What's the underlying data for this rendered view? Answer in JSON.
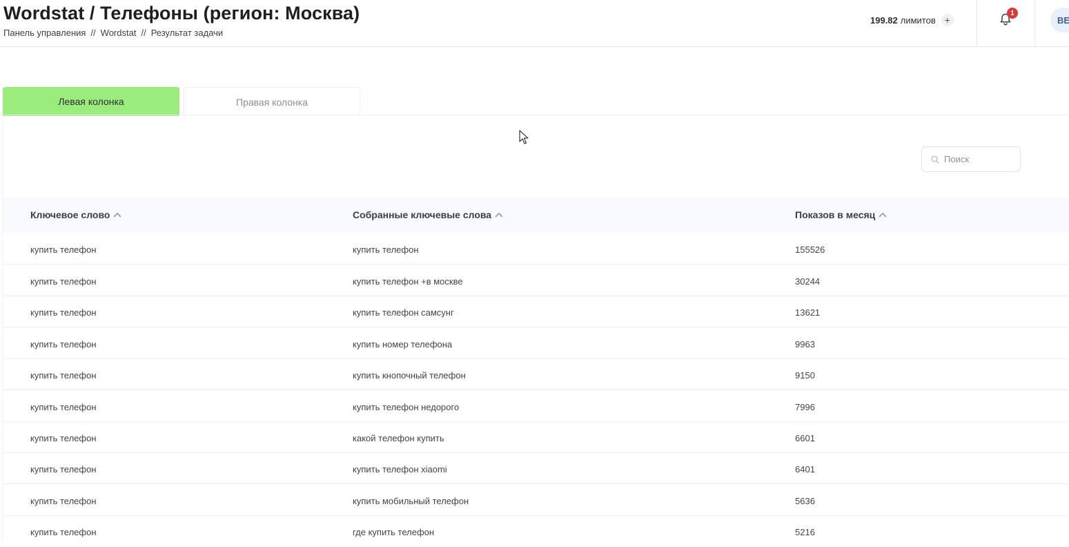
{
  "header": {
    "title": "Wordstat / Телефоны (регион: Москва)",
    "breadcrumb": [
      "Панель управления",
      "Wordstat",
      "Результат задачи"
    ],
    "breadcrumb_separator": "//",
    "limits_value": "199.82",
    "limits_label": "лимитов",
    "add_limits_label": "+",
    "notifications_count": "1",
    "avatar_initials": "BE"
  },
  "tabs": [
    {
      "label": "Левая колонка",
      "active": true
    },
    {
      "label": "Правая колонка",
      "active": false
    }
  ],
  "search": {
    "placeholder": "Поиск",
    "value": ""
  },
  "table": {
    "columns": [
      "Ключевое слово",
      "Собранные ключевые слова",
      "Показов в месяц"
    ],
    "rows": [
      [
        "купить телефон",
        "купить телефон",
        "155526"
      ],
      [
        "купить телефон",
        "купить телефон +в москве",
        "30244"
      ],
      [
        "купить телефон",
        "купить телефон самсунг",
        "13621"
      ],
      [
        "купить телефон",
        "купить номер телефона",
        "9963"
      ],
      [
        "купить телефон",
        "купить кнопочный телефон",
        "9150"
      ],
      [
        "купить телефон",
        "купить телефон недорого",
        "7996"
      ],
      [
        "купить телефон",
        "какой телефон купить",
        "6601"
      ],
      [
        "купить телефон",
        "купить телефон xiaomi",
        "6401"
      ],
      [
        "купить телефон",
        "купить мобильный телефон",
        "5636"
      ],
      [
        "купить телефон",
        "где купить телефон",
        "5216"
      ]
    ]
  },
  "colors": {
    "active_tab": "#9bec7c",
    "badge": "#d83a3a",
    "table_header_bg": "#f7f9fc"
  },
  "icons": [
    "plus-icon",
    "bell-icon",
    "search-icon",
    "sort-up-icon"
  ]
}
